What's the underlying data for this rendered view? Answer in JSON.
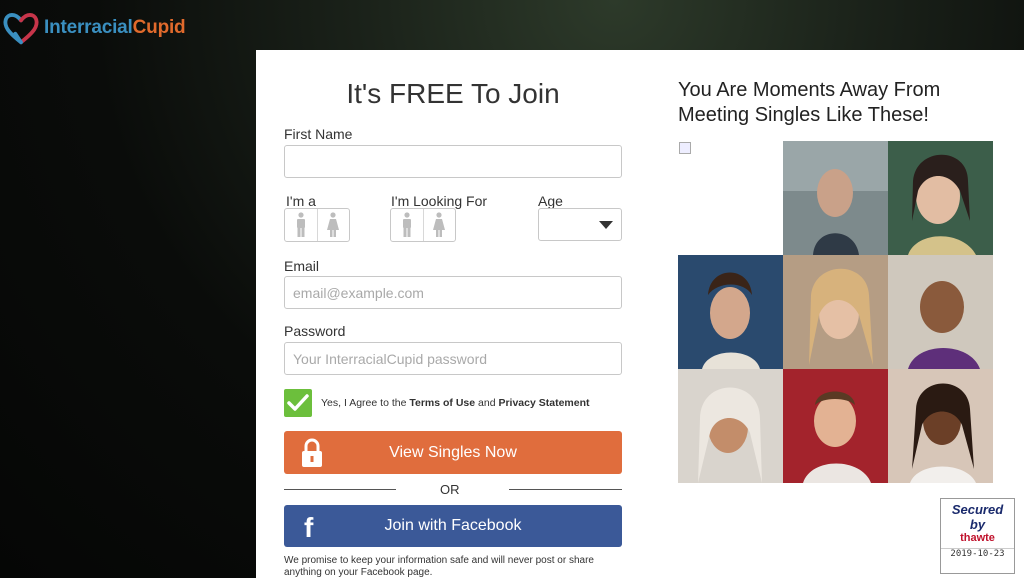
{
  "brand": {
    "part1": "Interracial",
    "part2": "Cupid"
  },
  "form": {
    "title": "It's FREE To Join",
    "first_name_label": "First Name",
    "first_name_value": "",
    "im_a_label": "I'm a",
    "looking_for_label": "I'm Looking For",
    "age_label": "Age",
    "email_label": "Email",
    "email_placeholder": "email@example.com",
    "password_label": "Password",
    "password_placeholder": "Your InterracialCupid password",
    "agree_prefix": "Yes, I Agree to the ",
    "terms_link": "Terms of Use",
    "agree_and": " and ",
    "privacy_link": "Privacy Statement",
    "agree_checked": true,
    "submit_label": "View Singles Now",
    "or_label": "OR",
    "facebook_label": "Join with Facebook",
    "facebook_icon": "f",
    "promise": "We promise to keep your information safe and will never post or share anything on your Facebook page."
  },
  "singles": {
    "title_line1": "You Are Moments Away From",
    "title_line2": "Meeting Singles Like These!"
  },
  "seal": {
    "line1": "Secured",
    "line2": "by",
    "line3": "thawte",
    "date": "2019-10-23"
  },
  "colors": {
    "cta": "#e06d3d",
    "facebook": "#3b5998",
    "check": "#6cbf3c",
    "brand_blue": "#3a8fc0",
    "brand_orange": "#e06a2c"
  }
}
